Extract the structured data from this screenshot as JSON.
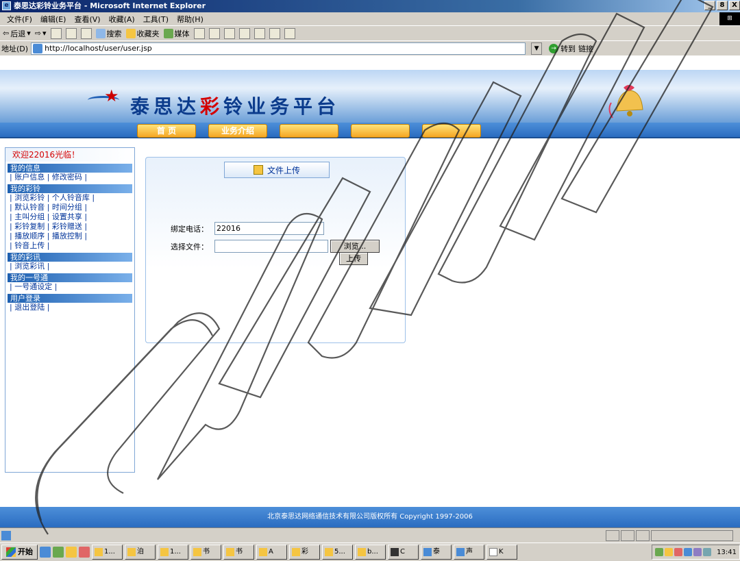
{
  "window": {
    "title": "泰思达彩铃业务平台 - Microsoft Internet Explorer",
    "buttons": [
      "_",
      "8",
      "X"
    ]
  },
  "menubar": [
    "文件(F)",
    "编辑(E)",
    "查看(V)",
    "收藏(A)",
    "工具(T)",
    "帮助(H)"
  ],
  "toolbar": {
    "back": "后退",
    "search": "搜索",
    "favorites": "收藏夹",
    "media": "媒体"
  },
  "addressbar": {
    "label": "地址(D)",
    "url": "http://localhost/user/user.jsp",
    "go": "转到",
    "links": "链接"
  },
  "site": {
    "title_a": "泰思达",
    "title_red": "彩",
    "title_b": "铃业务平台"
  },
  "nav": [
    "首 页",
    "业务介绍",
    "",
    "",
    ""
  ],
  "sidebar": {
    "welcome": "欢迎22016光临！",
    "sections": [
      {
        "title": "我的信息",
        "links": [
          "| 账户信息 | 修改密码 |"
        ]
      },
      {
        "title": "我的彩铃",
        "links": [
          "| 浏览彩铃 | 个人铃音库 |",
          "| 默认铃音 | 时间分组 |",
          "| 主叫分组 | 设置共享 |",
          "| 彩铃复制 | 彩铃赠送 |",
          "| 播放顺序 | 播放控制 |",
          "| 铃音上传 |"
        ]
      },
      {
        "title": "我的彩讯",
        "links": [
          "| 浏览彩讯 |"
        ]
      },
      {
        "title": "我的一号通",
        "links": [
          "| 一号通设定 |"
        ]
      },
      {
        "title": "用户登录",
        "links": [
          "| 退出登陆 |"
        ]
      }
    ]
  },
  "upload": {
    "title": "文件上传",
    "phone_label": "绑定电话：",
    "phone_value": "22016",
    "file_label": "选择文件：",
    "file_value": "",
    "browse": "浏览...",
    "submit": "上传"
  },
  "footer": "北京泰思达网络通信技术有限公司版权所有 Copyright 1997-2006",
  "taskbar": {
    "start": "开始",
    "tasks": [
      "1...",
      "泊",
      "1...",
      "书",
      "书",
      "A",
      "彩",
      "5...",
      "b...",
      "C",
      "泰",
      "声",
      "K"
    ],
    "clock": "13:41"
  }
}
